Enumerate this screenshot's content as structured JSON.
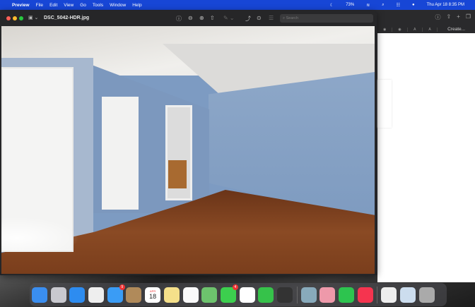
{
  "menubar": {
    "app": "Preview",
    "items": [
      "File",
      "Edit",
      "View",
      "Go",
      "Tools",
      "Window",
      "Help"
    ],
    "battery": "73%",
    "datetime": "Thu Apr 18  8:35 PM"
  },
  "window": {
    "title": "DSC_5042-HDR.jpg",
    "search_placeholder": "Search"
  },
  "backwindow": {
    "tabs": [
      "◉",
      "◉",
      "A",
      "A",
      "Create..."
    ]
  },
  "dock": {
    "apps": [
      {
        "name": "Finder",
        "color": "#3a8ef0"
      },
      {
        "name": "Launchpad",
        "color": "#c9c9cf"
      },
      {
        "name": "Safari",
        "color": "#2d8cf0"
      },
      {
        "name": "Chrome",
        "color": "#eee"
      },
      {
        "name": "Mail",
        "color": "#3a9cf5",
        "badge": "9"
      },
      {
        "name": "Contacts",
        "color": "#b08a5a"
      },
      {
        "name": "Calendar",
        "color": "#fff",
        "month": "APR",
        "day": "18"
      },
      {
        "name": "Notes",
        "color": "#f5e08a"
      },
      {
        "name": "Reminders",
        "color": "#fafafa"
      },
      {
        "name": "Maps",
        "color": "#6dc36d"
      },
      {
        "name": "Messages",
        "color": "#3ccf4e",
        "badge": "4"
      },
      {
        "name": "Photos",
        "color": "#fff"
      },
      {
        "name": "FaceTime",
        "color": "#36c24a"
      },
      {
        "name": "Final Cut Pro",
        "color": "#333"
      }
    ],
    "apps2": [
      {
        "name": "Preview",
        "color": "#8ab"
      },
      {
        "name": "Pixelmator",
        "color": "#e9a"
      },
      {
        "name": "WhatsApp",
        "color": "#2dc44f"
      },
      {
        "name": "Music",
        "color": "#f5344f"
      }
    ],
    "apps3": [
      {
        "name": "Document",
        "color": "#eee"
      },
      {
        "name": "Window",
        "color": "#cde"
      },
      {
        "name": "Trash",
        "color": "#aaa"
      }
    ]
  }
}
